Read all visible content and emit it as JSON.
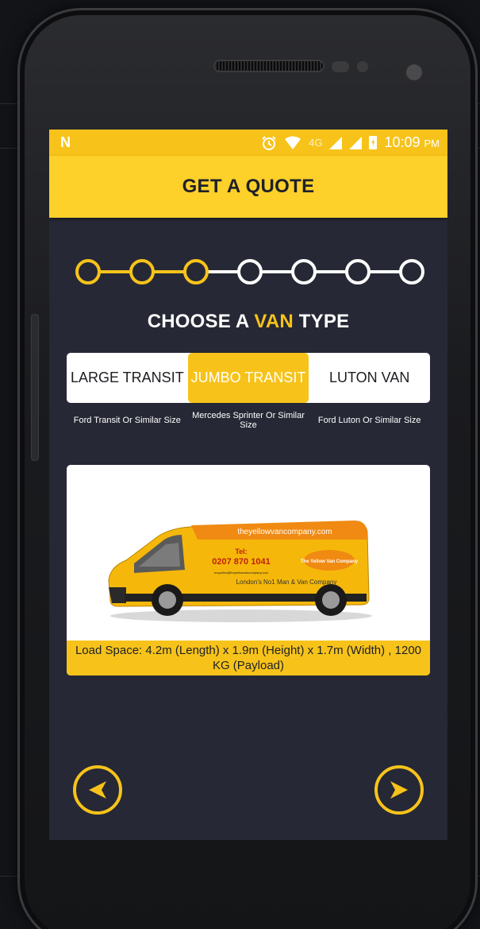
{
  "status": {
    "carrier_logo": "N",
    "network": "4G",
    "time": "10:09",
    "ampm": "PM",
    "icons": [
      "alarm-icon",
      "wifi-icon",
      "signal-icon",
      "battery-charging-icon"
    ]
  },
  "header": {
    "title": "GET A QUOTE"
  },
  "stepper": {
    "total": 7,
    "completed": 3
  },
  "heading": {
    "prefix": "CHOOSE A ",
    "highlight": "VAN",
    "suffix": " TYPE"
  },
  "van_types": [
    {
      "label": "LARGE TRANSIT",
      "subtitle": "Ford Transit Or Similar Size",
      "selected": false
    },
    {
      "label": "JUMBO TRANSIT",
      "subtitle": "Mercedes Sprinter Or Similar Size",
      "selected": true
    },
    {
      "label": "LUTON VAN",
      "subtitle": "Ford Luton Or Similar Size",
      "selected": false
    }
  ],
  "van_image": {
    "website": "theyellowvancompany.com",
    "phone_label": "Tel:",
    "phone": "0207 870 1041",
    "email": "enquiries@theyellowvancompany.com",
    "brand": "The Yellow Van Company",
    "tagline": "London's No1 Man & Van Company"
  },
  "load_space": "Load Space: 4.2m (Length) x 1.9m (Height) x 1.7m (Width) , 1200 KG (Payload)",
  "nav": {
    "back_icon": "arrow-left-icon",
    "next_icon": "arrow-right-icon"
  },
  "colors": {
    "accent": "#f7c31a",
    "background": "#262835",
    "header": "#fdd02a"
  }
}
